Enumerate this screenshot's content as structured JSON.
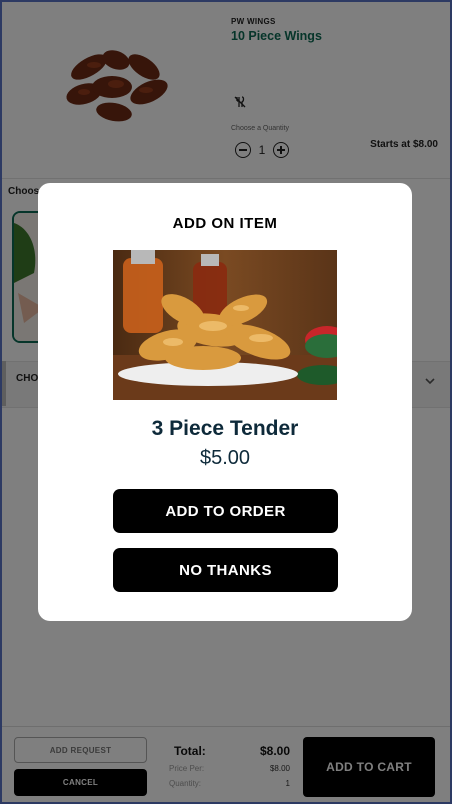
{
  "product": {
    "store": "PW WINGS",
    "name": "10 Piece Wings",
    "image_icon": "chicken-wings-photo",
    "diet_icon": "no-utensils-icon",
    "quantity_label": "Choose a Quantity",
    "quantity": "1",
    "starts_at": "Starts at $8.00"
  },
  "options": {
    "choose_label": "Choos",
    "choice_label": "CHO"
  },
  "footer": {
    "add_request": "ADD REQUEST",
    "cancel": "CANCEL",
    "total_label": "Total:",
    "total_value": "$8.00",
    "price_per_label": "Price Per:",
    "price_per_value": "$8.00",
    "quantity_label": "Quantity:",
    "quantity_value": "1",
    "add_to_cart": "ADD TO CART"
  },
  "modal": {
    "title": "ADD ON ITEM",
    "item_name": "3 Piece Tender",
    "price": "$5.00",
    "add_button": "ADD TO ORDER",
    "decline_button": "NO THANKS",
    "image_icon": "chicken-tenders-photo"
  },
  "colors": {
    "accent": "#0d6b54",
    "frame": "#2d3a63",
    "button": "#000000"
  }
}
